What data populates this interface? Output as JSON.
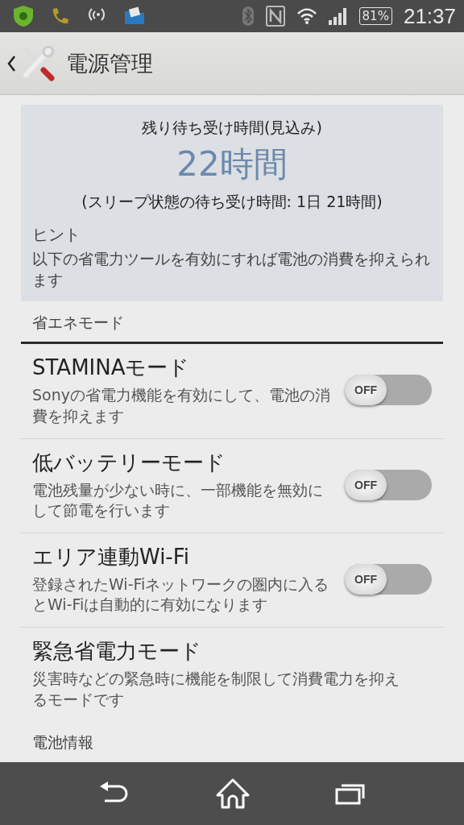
{
  "status_bar": {
    "battery": "81%",
    "time": "21:37"
  },
  "header": {
    "title": "電源管理"
  },
  "summary": {
    "caption": "残り待ち受け時間(見込み)",
    "value": "22時間",
    "detail": "(スリープ状態の待ち受け時間: 1日 21時間)",
    "hint_title": "ヒント",
    "hint": "以下の省電力ツールを有効にすれば電池の消費を抑えられます"
  },
  "section": {
    "title": "省エネモード"
  },
  "items": [
    {
      "kind": "toggle",
      "title": "STAMINAモード",
      "description": "Sonyの省電力機能を有効にして、電池の消費を抑えます",
      "on": false,
      "toggle_label": "OFF"
    },
    {
      "kind": "toggle",
      "title": "低バッテリーモード",
      "description": "電池残量が少ない時に、一部機能を無効にして節電を行います",
      "on": false,
      "toggle_label": "OFF"
    },
    {
      "kind": "toggle",
      "title": "エリア連動Wi-Fi",
      "description": "登録されたWi-Fiネットワークの圏内に入るとWi-Fiは自動的に有効になります",
      "on": false,
      "toggle_label": "OFF"
    },
    {
      "kind": "text",
      "title": "緊急省電力モード",
      "description": "災害時などの緊急時に機能を制限して消費電力を抑えるモードです"
    }
  ],
  "next_section": {
    "title": "電池情報"
  }
}
